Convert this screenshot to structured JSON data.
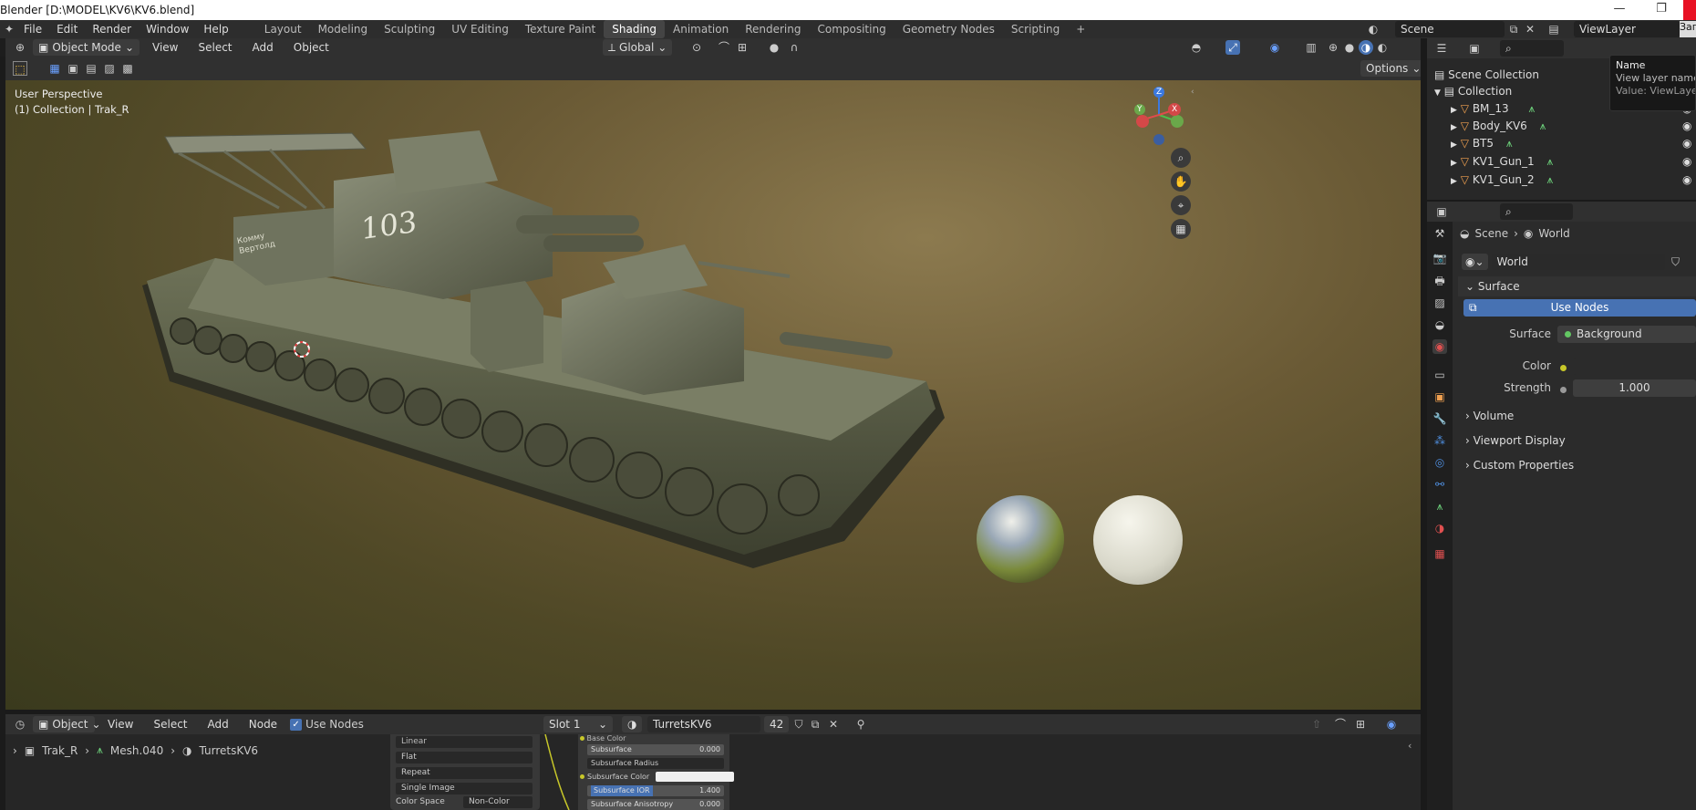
{
  "window": {
    "title": "Blender [D:\\MODEL\\KV6\\KV6.blend]",
    "minimize": "—",
    "restore": "❐"
  },
  "menu": [
    "File",
    "Edit",
    "Render",
    "Window",
    "Help"
  ],
  "workspaces": {
    "tabs": [
      "Layout",
      "Modeling",
      "Sculpting",
      "UV Editing",
      "Texture Paint",
      "Shading",
      "Animation",
      "Rendering",
      "Compositing",
      "Geometry Nodes",
      "Scripting"
    ],
    "active": "Shading",
    "add": "+"
  },
  "scene": {
    "name": "Scene"
  },
  "view_layer": {
    "name": "ViewLayer",
    "partial_button": "Заг"
  },
  "tooltip": {
    "title": "Name",
    "line1": "View layer name",
    "line2": "Value: ViewLayer"
  },
  "viewport_header": {
    "mode": "Object Mode",
    "menus": [
      "View",
      "Select",
      "Add",
      "Object"
    ],
    "transform_orientation": "Global"
  },
  "viewport_toolbar": {
    "options": "Options"
  },
  "viewport": {
    "perspective": "User Perspective",
    "collection_info": "(1) Collection | Trak_R",
    "gizmo": {
      "x": "X",
      "y": "Y",
      "z": "Z"
    },
    "decal_number": "103",
    "decal_text": [
      "Комму",
      "Вертолд"
    ]
  },
  "node_header": {
    "editor_type": "Object",
    "menus": [
      "View",
      "Select",
      "Add",
      "Node"
    ],
    "use_nodes_label": "Use Nodes",
    "use_nodes_checked": true,
    "slot": "Slot 1",
    "material": "TurretsKV6",
    "users": "42"
  },
  "breadcrumb": {
    "object": "Trak_R",
    "mesh": "Mesh.040",
    "material": "TurretsKV6"
  },
  "node_image": {
    "rows": [
      "Linear",
      "Flat",
      "Repeat",
      "Single Image"
    ],
    "color_space_label": "Color Space",
    "color_space_value": "Non-Color"
  },
  "node_bsdf": {
    "rows": [
      {
        "label": "Base Color",
        "value": ""
      },
      {
        "label": "Subsurface",
        "value": "0.000"
      },
      {
        "label": "Subsurface Radius",
        "value": ""
      },
      {
        "label": "Subsurface Color",
        "value": ""
      },
      {
        "label": "Subsurface IOR",
        "value": "1.400"
      },
      {
        "label": "Subsurface Anisotropy",
        "value": "0.000"
      }
    ]
  },
  "outliner": {
    "root": "Scene Collection",
    "collection": "Collection",
    "items": [
      "BM_13",
      "Body_KV6",
      "BT5",
      "KV1_Gun_1",
      "KV1_Gun_2"
    ]
  },
  "properties": {
    "breadcrumb": {
      "scene": "Scene",
      "world": "World"
    },
    "world_name": "World",
    "surface_panel": "Surface",
    "use_nodes_button": "Use Nodes",
    "surface_label": "Surface",
    "surface_value": "Background",
    "color_label": "Color",
    "strength_label": "Strength",
    "strength_value": "1.000",
    "collapsed_panels": [
      "Volume",
      "Viewport Display",
      "Custom Properties"
    ]
  },
  "colors": {
    "accent_blue": "#4772b3",
    "active_tab": "#444444",
    "header_bg": "#303030",
    "socket_green": "#63c763",
    "socket_yellow": "#c7c729"
  }
}
